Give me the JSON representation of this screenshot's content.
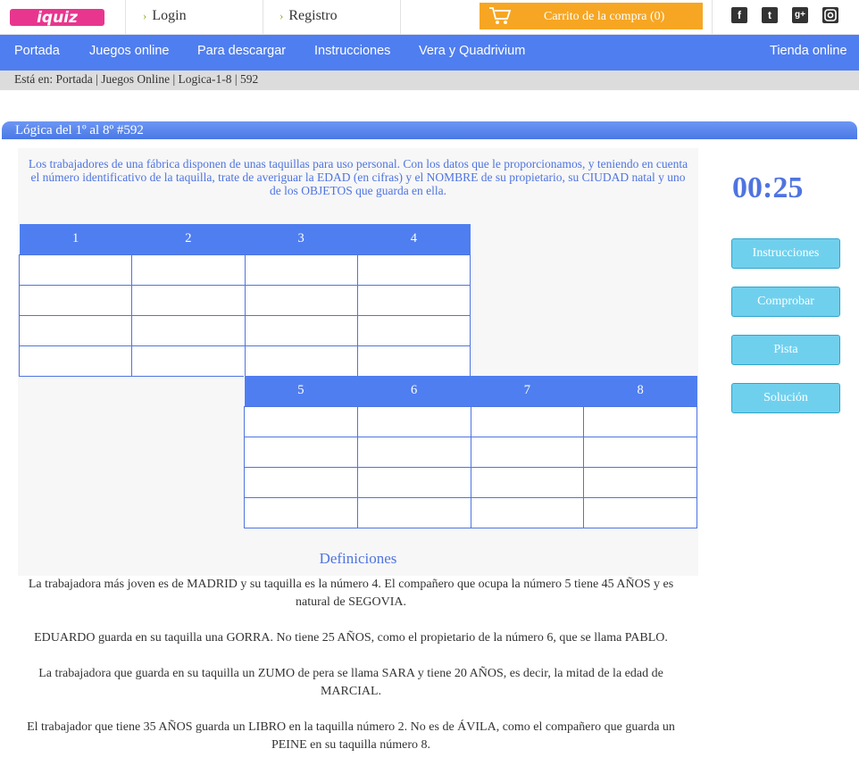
{
  "header": {
    "logo_text": "iquiz",
    "login_label": "Login",
    "register_label": "Registro",
    "cart_label": "Carrito de la compra (0)",
    "social_icons": [
      "facebook-icon",
      "twitter-icon",
      "google-plus-icon",
      "instagram-icon"
    ]
  },
  "nav": {
    "items": [
      "Portada",
      "Juegos online",
      "Para descargar",
      "Instrucciones",
      "Vera y Quadrivium"
    ],
    "shop_label": "Tienda online"
  },
  "breadcrumb": {
    "prefix": "Está en:",
    "items": [
      "Portada",
      "Juegos Online",
      "Logica-1-8",
      "592"
    ]
  },
  "title": "Lógica del 1º al 8º #592",
  "intro": "Los trabajadores de una fábrica disponen de unas taquillas para uso personal. Con los datos que le proporcionamos, y teniendo en cuenta el número identificativo de la taquilla, trate de averiguar la EDAD (en cifras) y el NOMBRE de su propietario, su CIUDAD natal y uno de los OBJETOS que guarda en ella.",
  "grid_top": {
    "headers": [
      "1",
      "2",
      "3",
      "4"
    ]
  },
  "grid_bottom": {
    "headers": [
      "5",
      "6",
      "7",
      "8"
    ]
  },
  "definitions": {
    "title": "Definiciones",
    "items": [
      "La trabajadora más joven es de MADRID y su taquilla es la número 4. El compañero que ocupa la número 5 tiene 45 AÑOS y es natural de SEGOVIA.",
      "EDUARDO guarda en su taquilla una GORRA. No tiene 25 AÑOS, como el propietario de la número 6, que se llama PABLO.",
      "La trabajadora que guarda en su taquilla un ZUMO de pera se llama SARA y tiene 20 AÑOS, es decir, la mitad de la edad de MARCIAL.",
      "El trabajador que tiene 35 AÑOS guarda un LIBRO en la taquilla número 2. No es de ÁVILA, como el compañero que guarda un PEINE en su taquilla número 8."
    ]
  },
  "sidebar": {
    "timer": "00:25",
    "buttons": [
      "Instrucciones",
      "Comprobar",
      "Pista",
      "Solución"
    ]
  },
  "colors": {
    "nav_blue": "#4f7ef0",
    "text_blue": "#4f74e0",
    "cart_orange": "#f6a623",
    "button_cyan": "#6fd0ee"
  }
}
